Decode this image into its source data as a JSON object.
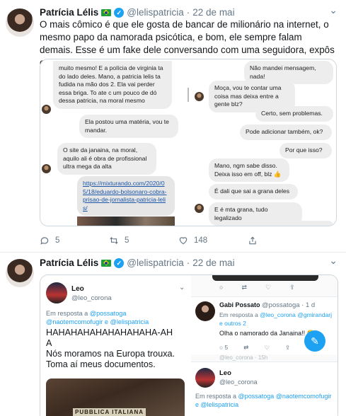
{
  "tweet1": {
    "name": "Patrícia Lélis",
    "handle": "@lelispatricia",
    "sep": "·",
    "date": "22 de mai",
    "text": "O mais cômico é que ele gosta de bancar de milionário na internet, o mesmo papo da namorada psicótica, e bom, ele sempre falam demais. Esse é um fake dele conversando com uma seguidora, expôs o planinho ein?!",
    "left_chat": {
      "b1": "muito mesmo! E a polícia de virginia ta do lado deles. Mano, a patricia lelis ta fudida na mão dos 2. Ela vai perder essa briga. To ate c um pouco de dó dessa patricia, na moral mesmo",
      "b2": "Ela postou uma matéria, vou te mandar.",
      "b3": "O site da janaina, na moral, aquilo ali é obra de profissional ultra mega da alta",
      "link": "https://mixturando.com/2020/05/18/eduardo-bolsonaro-cobra-prisao-de-jornalista-patricia-lelis/"
    },
    "right_chat": {
      "b1": "Não mandei mensagem, nada!",
      "b2": "Moça, vou te contar uma coisa mas deixa entre a gente blz?",
      "b3": "Certo, sem problemas.",
      "b4": "Pode adicionar também, ok?",
      "b5": "Por que isso?",
      "b6": "Mano, ngm sabe disso. Deixa isso em off, blz 👍",
      "b7": "É dali que sai a grana deles",
      "b8": "E é mta grana, tudo legalizado"
    },
    "actions": {
      "replies": "5",
      "retweets": "5",
      "likes": "148"
    }
  },
  "tweet2": {
    "name": "Patrícia Lélis",
    "handle": "@lelispatricia",
    "sep": "·",
    "date": "22 de mai",
    "left": {
      "name": "Leo",
      "handle": "@leo_corona",
      "reply_prefix": "Em resposta a",
      "reply_to": "@possatoga @naotemcomofugir e @lelispatricia",
      "text1": "HAHAHAHAHAHAHAHAHA-AHA",
      "text2": "Nós moramos na Europa trouxa. Toma aí meus documentos.",
      "doc_label": "PUBBLICA ITALIANA"
    },
    "right": {
      "reply_author": "Gabi Possato",
      "reply_author_handle": "@possatoga · 1 d",
      "reply_prefix": "Em resposta a",
      "reply_to": "@leo_corona @gmirandarj e outros 2",
      "reply_text": "Olha o namorado da Janaina!! 😂",
      "name2": "Leo",
      "handle2": "@leo_corona",
      "reply_prefix2": "Em resposta a",
      "reply_to2": "@possatoga @naotemcomofugir e @lelispatricia",
      "stat_replies": "5",
      "stat_retweet": "",
      "stat_like": "",
      "stat_share": ""
    }
  }
}
